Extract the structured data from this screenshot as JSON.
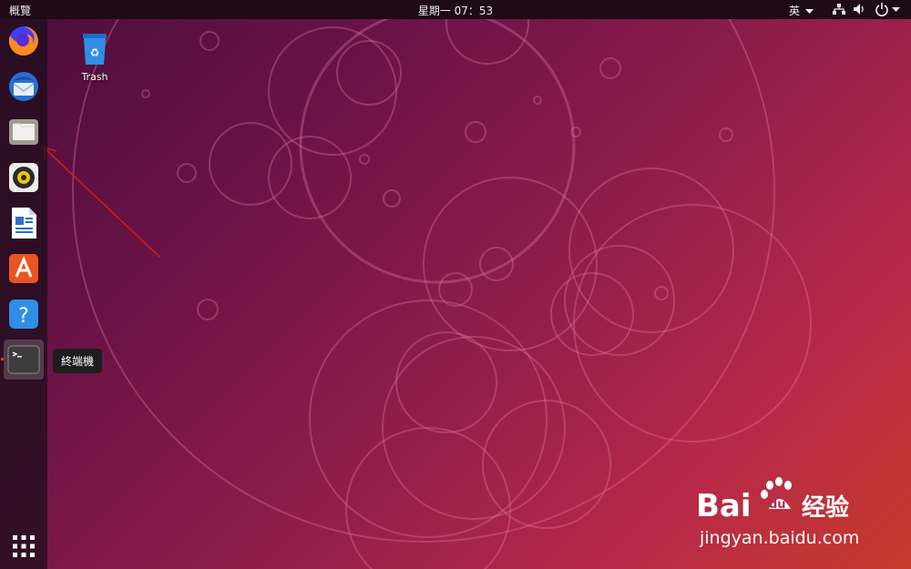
{
  "topbar": {
    "activities": "概覽",
    "clock": "星期一 07：53",
    "input_method": "英"
  },
  "desktop": {
    "trash_label": "Trash"
  },
  "dock": {
    "items": [
      "firefox",
      "thunderbird",
      "files",
      "rhythmbox",
      "libreoffice-writer",
      "ubuntu-software",
      "help",
      "terminal"
    ],
    "tooltip": "終端機"
  },
  "watermark": {
    "brand": "Bai",
    "brand_suffix": "du",
    "cn": "经验",
    "url": "jingyan.baidu.com"
  },
  "colors": {
    "accent": "#e95420",
    "annotation": "#d11a1a",
    "topbar": "#1f0a17"
  }
}
